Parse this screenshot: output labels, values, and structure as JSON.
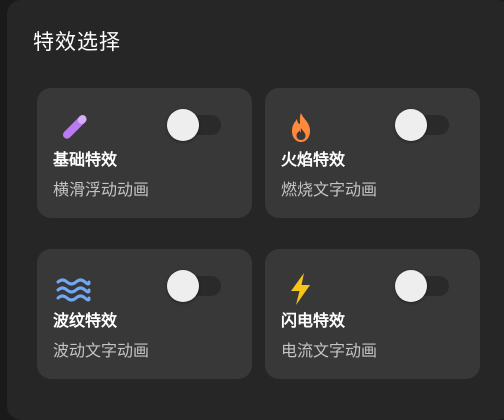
{
  "panel": {
    "title": "特效选择"
  },
  "cards": [
    {
      "name": "基础特效",
      "description": "横滑浮动动画",
      "icon": "magic-wand-icon",
      "icon_color": "#b87cf0",
      "enabled": false
    },
    {
      "name": "火焰特效",
      "description": "燃烧文字动画",
      "icon": "flame-icon",
      "icon_color": "#ff8a3d",
      "enabled": false
    },
    {
      "name": "波纹特效",
      "description": "波动文字动画",
      "icon": "waves-icon",
      "icon_color": "#6fa8f5",
      "enabled": false
    },
    {
      "name": "闪电特效",
      "description": "电流文字动画",
      "icon": "lightning-icon",
      "icon_color": "#f5c518",
      "enabled": false
    }
  ],
  "colors": {
    "background": "#1a1a1a",
    "panel": "#262626",
    "card": "#383838",
    "text_primary": "#ffffff",
    "text_secondary": "#c4c4c4",
    "toggle_track_off": "#2a2a2a",
    "toggle_knob": "#eeeeee"
  }
}
